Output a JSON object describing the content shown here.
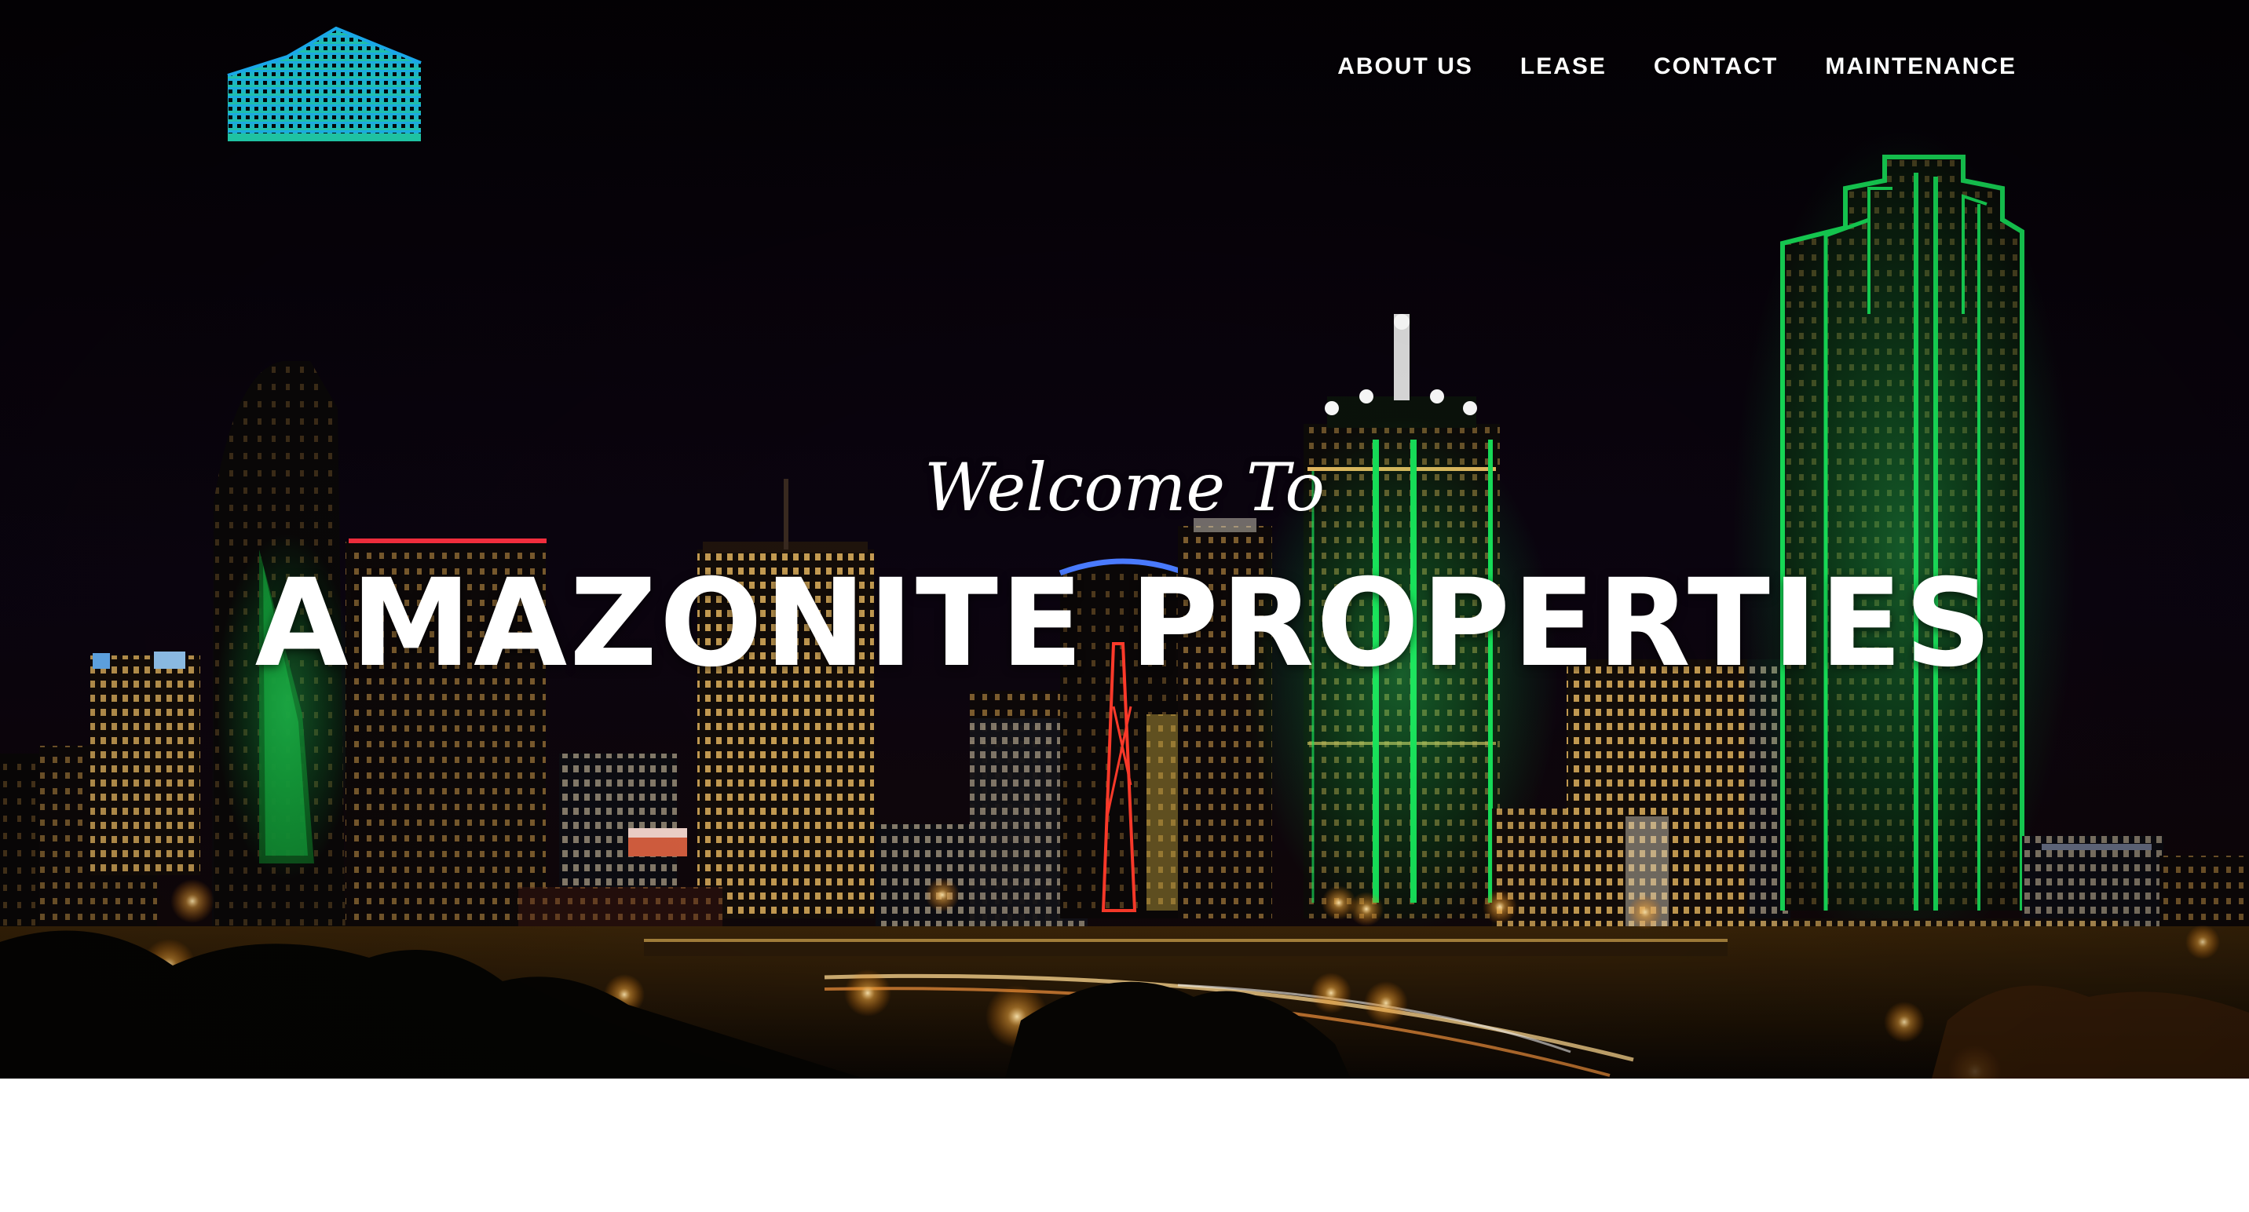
{
  "header": {
    "logo_icon": "building-logo-icon",
    "nav": [
      {
        "label": "ABOUT US"
      },
      {
        "label": "LEASE"
      },
      {
        "label": "CONTACT"
      },
      {
        "label": "MAINTENANCE"
      }
    ]
  },
  "hero": {
    "welcome": "Welcome To",
    "title": "AMAZONITE PROPERTIES",
    "background": "city-skyline-night"
  },
  "colors": {
    "logo_top": "#1aa7e8",
    "logo_bottom": "#1fc2a2",
    "skyline_green": "#18e05a",
    "night_sky": "#050207",
    "text": "#ffffff"
  }
}
